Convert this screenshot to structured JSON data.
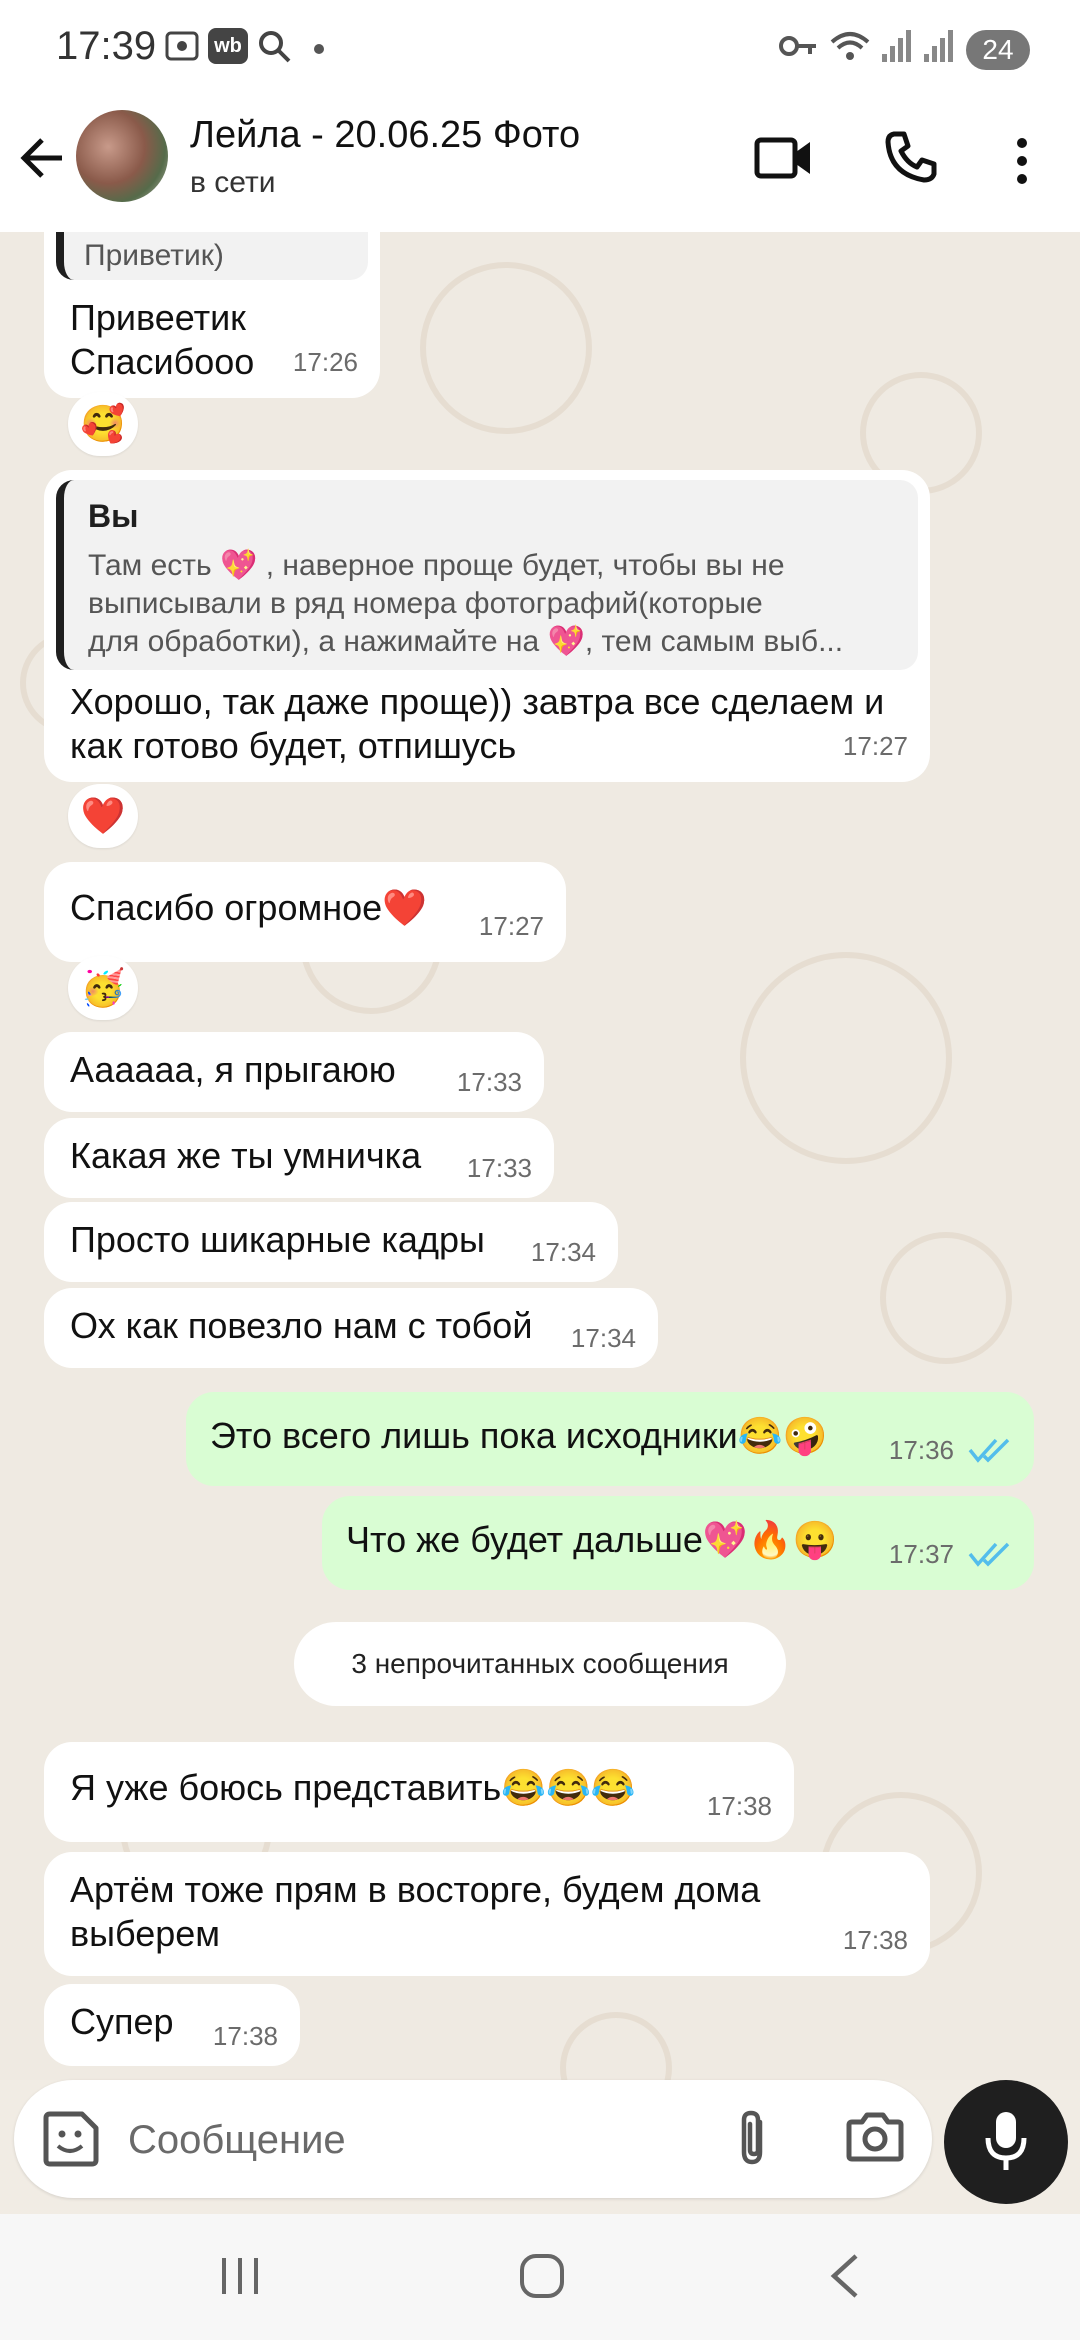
{
  "status_bar": {
    "time": "17:39",
    "battery": "24"
  },
  "header": {
    "contact_name": "Лейла - 20.06.25 Фото",
    "contact_status": "в сети"
  },
  "messages": [
    {
      "text": "Приветик)",
      "partial": true
    },
    {
      "lines": [
        "Привеетик",
        "Спасибооо"
      ],
      "time": "17:26",
      "reaction": "🥰"
    },
    {
      "quote_author": "Вы",
      "quote_lines": [
        "Там есть 💖 , наверное проще будет, чтобы вы не",
        "выписывали в ряд номера фотографий(которые",
        "для обработки), а нажимайте на 💖, тем самым выб..."
      ],
      "lines": [
        "Хорошо, так даже проще)) завтра все сделаем и",
        "как готово будет, отпишусь"
      ],
      "time": "17:27",
      "reaction": "❤️"
    },
    {
      "lines": [
        "Спасибо огромное❤️"
      ],
      "time": "17:27",
      "reaction": "🥳"
    },
    {
      "lines": [
        "Аааааа, я прыгаюю"
      ],
      "time": "17:33"
    },
    {
      "lines": [
        "Какая же ты умничка"
      ],
      "time": "17:33"
    },
    {
      "lines": [
        "Просто шикарные кадры"
      ],
      "time": "17:34"
    },
    {
      "lines": [
        "Ох как повезло нам с тобой"
      ],
      "time": "17:34"
    },
    {
      "lines": [
        "Это всего лишь пока исходники😂🤪"
      ],
      "time": "17:36"
    },
    {
      "lines": [
        "Что же будет дальше💖🔥😛"
      ],
      "time": "17:37"
    },
    {
      "lines": [
        "Я уже боюсь представить😂😂😂"
      ],
      "time": "17:38"
    },
    {
      "lines": [
        "Артём тоже прям в восторге, будем дома",
        "выберем"
      ],
      "time": "17:38"
    },
    {
      "lines": [
        "Супер"
      ],
      "time": "17:38"
    }
  ],
  "unread_label": "3 непрочитанных сообщения",
  "input": {
    "placeholder": "Сообщение"
  },
  "colors": {
    "incoming": "#ffffff",
    "outgoing": "#d9fdd3",
    "read_ticks": "#53bdeb",
    "background": "#efeae2"
  }
}
